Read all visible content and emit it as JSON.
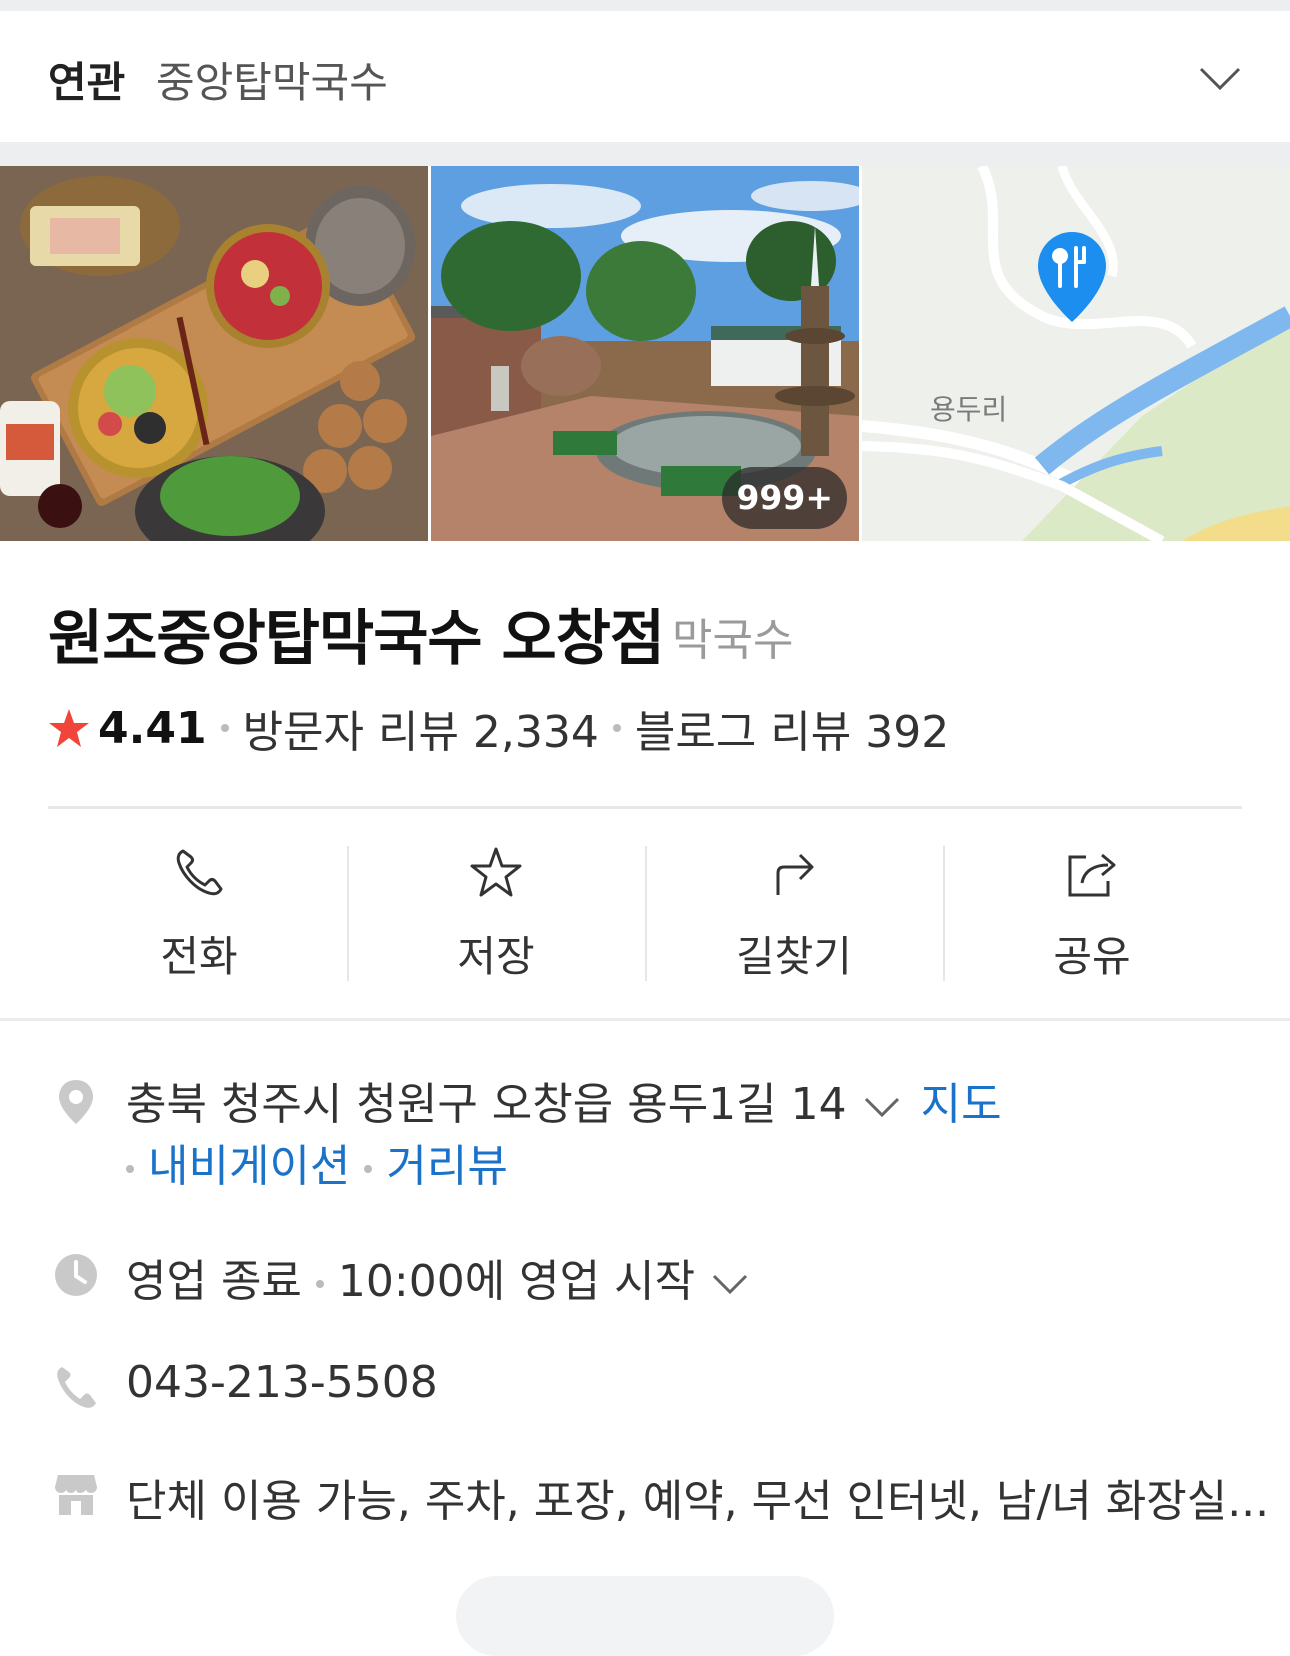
{
  "related": {
    "label": "연관",
    "keyword": "중앙탑막국수"
  },
  "photos": {
    "count_badge": "999+",
    "map_place_label": "용두리"
  },
  "place": {
    "name": "원조중앙탑막국수 오창점",
    "category": "막국수",
    "rating": "4.41",
    "visitor_reviews": "방문자 리뷰 2,334",
    "blog_reviews": "블로그 리뷰 392"
  },
  "actions": [
    {
      "label": "전화",
      "icon": "phone-icon"
    },
    {
      "label": "저장",
      "icon": "star-icon"
    },
    {
      "label": "길찾기",
      "icon": "directions-icon"
    },
    {
      "label": "공유",
      "icon": "share-icon"
    }
  ],
  "info": {
    "address": "충북 청주시 청원구 오창읍 용두1길 14",
    "map_link": "지도",
    "navigation_link": "내비게이션",
    "street_view_link": "거리뷰",
    "status": "영업 종료",
    "hours": "10:00에 영업 시작",
    "phone": "043-213-5508",
    "amenities": "단체 이용 가능, 주차, 포장, 예약, 무선 인터넷, 남/녀 화장실..."
  },
  "colors": {
    "link": "#1a73c8",
    "star": "#f0453a",
    "map_pin": "#1c8ef0"
  }
}
